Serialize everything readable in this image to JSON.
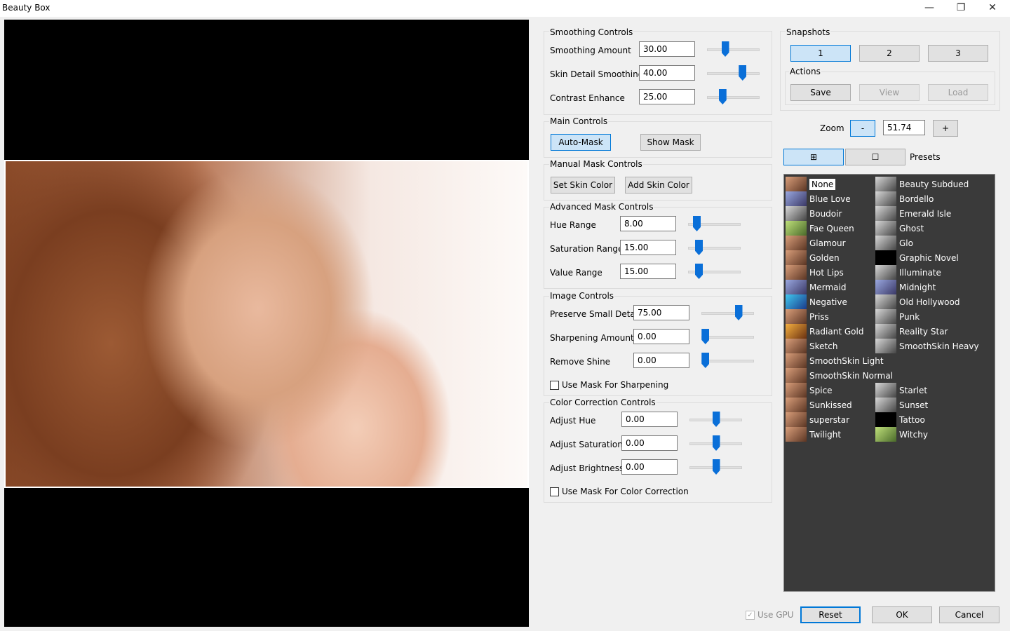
{
  "window": {
    "title": "Beauty Box",
    "minimize_glyph": "—",
    "restore_glyph": "❐",
    "close_glyph": "✕"
  },
  "smoothing": {
    "title": "Smoothing Controls",
    "rows": [
      {
        "label": "Smoothing Amount",
        "value": "30.00",
        "slider_pct": 34
      },
      {
        "label": "Skin Detail Smoothing",
        "value": "40.00",
        "slider_pct": 67
      },
      {
        "label": "Contrast Enhance",
        "value": "25.00",
        "slider_pct": 29
      }
    ]
  },
  "main_controls": {
    "title": "Main Controls",
    "auto_mask": "Auto-Mask",
    "show_mask": "Show Mask"
  },
  "manual_mask": {
    "title": "Manual Mask Controls",
    "set_skin": "Set Skin Color",
    "add_skin": "Add Skin Color"
  },
  "advanced_mask": {
    "title": "Advanced Mask Controls",
    "rows": [
      {
        "label": "Hue Range",
        "value": "8.00",
        "slider_pct": 16
      },
      {
        "label": "Saturation Range",
        "value": "15.00",
        "slider_pct": 20
      },
      {
        "label": "Value Range",
        "value": "15.00",
        "slider_pct": 20
      }
    ]
  },
  "image_controls": {
    "title": "Image Controls",
    "rows": [
      {
        "label": "Preserve Small Detail",
        "value": "75.00",
        "slider_pct": 70
      },
      {
        "label": "Sharpening Amount",
        "value": "0.00",
        "slider_pct": 7
      },
      {
        "label": "Remove Shine",
        "value": "0.00",
        "slider_pct": 7
      }
    ],
    "use_mask_sharpening": "Use Mask For Sharpening"
  },
  "color_correction": {
    "title": "Color Correction Controls",
    "rows": [
      {
        "label": "Adjust Hue",
        "value": "0.00",
        "slider_pct": 50
      },
      {
        "label": "Adjust Saturation",
        "value": "0.00",
        "slider_pct": 50
      },
      {
        "label": "Adjust Brightness",
        "value": "0.00",
        "slider_pct": 50
      }
    ],
    "use_mask_color": "Use Mask For Color Correction"
  },
  "snapshots": {
    "title": "Snapshots",
    "buttons": [
      "1",
      "2",
      "3"
    ]
  },
  "actions": {
    "title": "Actions",
    "save": "Save",
    "view": "View",
    "load": "Load"
  },
  "zoom": {
    "label": "Zoom",
    "minus": "-",
    "value": "51.74",
    "plus": "+"
  },
  "view_toggle": {
    "grid_glyph": "⊞",
    "single_glyph": "☐",
    "presets_label": "Presets"
  },
  "presets_left": [
    "None",
    "Blue Love",
    "Boudoir",
    "Fae Queen",
    "Glamour",
    "Golden",
    "Hot Lips",
    "Mermaid",
    "Negative",
    "Priss",
    "Radiant Gold",
    "Sketch",
    "SmoothSkin Light",
    "SmoothSkin Normal",
    "Spice",
    "Sunkissed",
    "superstar",
    "Twilight"
  ],
  "presets_right": [
    "Beauty Subdued",
    "Bordello",
    "Emerald Isle",
    "Ghost",
    "Glo",
    "Graphic Novel",
    "Illuminate",
    "Midnight",
    "Old Hollywood",
    "Punk",
    "Reality Star",
    "SmoothSkin Heavy",
    "",
    "",
    "Starlet",
    "Sunset",
    "Tattoo",
    "Witchy"
  ],
  "footer": {
    "use_gpu": "Use GPU",
    "reset": "Reset",
    "ok": "OK",
    "cancel": "Cancel"
  }
}
